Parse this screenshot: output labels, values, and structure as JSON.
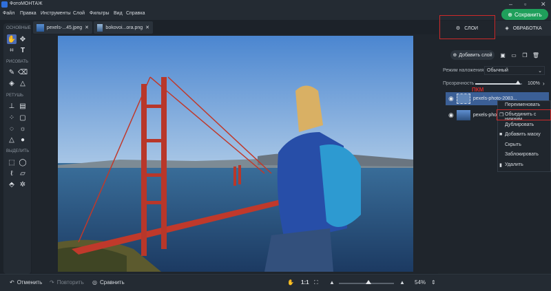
{
  "app": {
    "title": "ФотоМОНТАЖ"
  },
  "menu": [
    "Файл",
    "Правка",
    "Инструменты",
    "Слой",
    "Фильтры",
    "Вид",
    "Справка"
  ],
  "save_label": "Сохранить",
  "tools": {
    "sections": [
      "ОСНОВНЫЕ",
      "РИСОВАТЬ",
      "РЕТУШЬ",
      "ВЫДЕЛИТЬ"
    ]
  },
  "tabs": [
    {
      "label": "pexels-...45.jpeg"
    },
    {
      "label": "bokovoi...ora.png"
    }
  ],
  "panel": {
    "tab_layers": "СЛОИ",
    "tab_processing": "ОБРАБОТКА",
    "add_layer": "Добавить слой",
    "blend_label": "Режим наложения:",
    "blend_value": "Обычный",
    "opacity_label": "Прозрачность",
    "opacity_value": "100%",
    "opacity_level": 1.0,
    "annotation": "ПКМ",
    "layers": [
      {
        "name": "pexels-photo-2083..."
      },
      {
        "name": "pexels-phot..."
      }
    ]
  },
  "context_menu": [
    "Переименовать",
    "Объединить с нижним",
    "Дублировать",
    "Добавить маску",
    "Скрыть",
    "Заблокировать",
    "Удалить"
  ],
  "bottom": {
    "undo": "Отменить",
    "redo": "Повторить",
    "compare": "Сравнить",
    "ratio": "1:1",
    "zoom": "54%",
    "zoom_level": 0.54
  },
  "colors": {
    "accent": "#1f9f5b",
    "highlight": "#d02a2a",
    "selected_layer": "#3b5f96"
  }
}
